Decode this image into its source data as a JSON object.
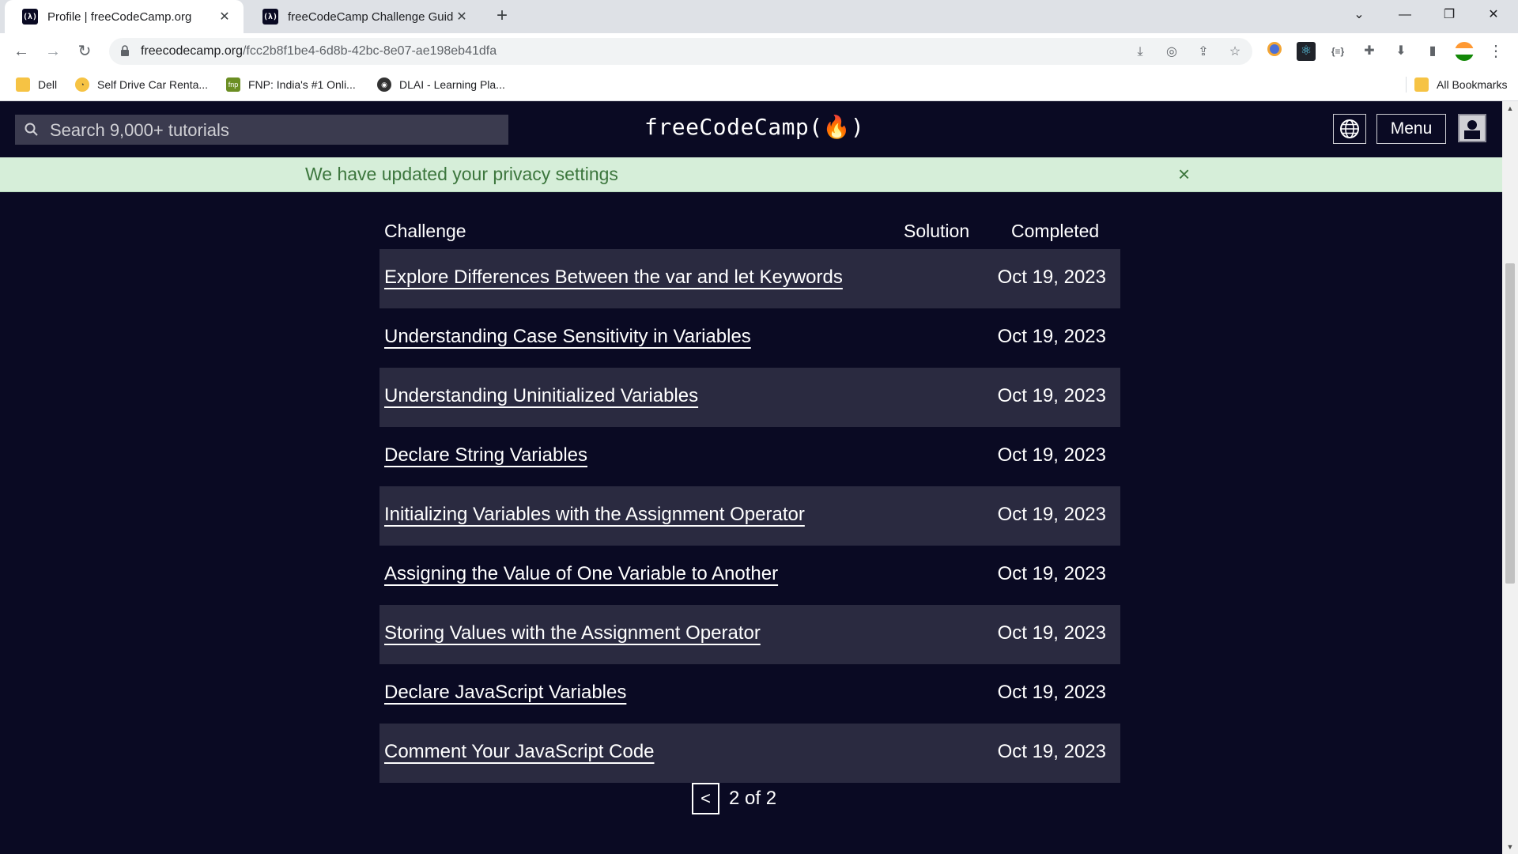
{
  "browser": {
    "tabs": [
      {
        "title": "Profile | freeCodeCamp.org",
        "active": true
      },
      {
        "title": "freeCodeCamp Challenge Guide",
        "active": false
      }
    ],
    "url_host": "freecodecamp.org",
    "url_path": "/fcc2b8f1be4-6d8b-42bc-8e07-ae198eb41dfa",
    "bookmarks": [
      {
        "label": "Dell",
        "icon": "folder-icon"
      },
      {
        "label": "Self Drive Car Renta...",
        "icon": "car-rental-icon"
      },
      {
        "label": "FNP: India's #1 Onli...",
        "icon": "fnp-icon"
      },
      {
        "label": "DLAI - Learning Pla...",
        "icon": "globe-icon"
      }
    ],
    "all_bookmarks": "All Bookmarks"
  },
  "nav": {
    "search_placeholder": "Search 9,000+ tutorials",
    "logo": "freeCodeCamp(🔥)",
    "menu_label": "Menu"
  },
  "flash": {
    "message": "We have updated your privacy settings",
    "close": "×"
  },
  "timeline": {
    "headers": {
      "challenge": "Challenge",
      "solution": "Solution",
      "completed": "Completed"
    },
    "rows": [
      {
        "challenge": "Explore Differences Between the var and let Keywords",
        "completed": "Oct 19, 2023"
      },
      {
        "challenge": "Understanding Case Sensitivity in Variables",
        "completed": "Oct 19, 2023"
      },
      {
        "challenge": "Understanding Uninitialized Variables",
        "completed": "Oct 19, 2023"
      },
      {
        "challenge": "Declare String Variables",
        "completed": "Oct 19, 2023"
      },
      {
        "challenge": "Initializing Variables with the Assignment Operator",
        "completed": "Oct 19, 2023"
      },
      {
        "challenge": "Assigning the Value of One Variable to Another",
        "completed": "Oct 19, 2023"
      },
      {
        "challenge": "Storing Values with the Assignment Operator",
        "completed": "Oct 19, 2023"
      },
      {
        "challenge": "Declare JavaScript Variables",
        "completed": "Oct 19, 2023"
      },
      {
        "challenge": "Comment Your JavaScript Code",
        "completed": "Oct 19, 2023"
      }
    ],
    "pager": {
      "prev": "<",
      "text": "2 of 2"
    }
  },
  "colors": {
    "page_bg": "#0a0a23",
    "row_alt": "#2a2a40",
    "flash_bg": "#d6eed9",
    "flash_text": "#3c763d"
  }
}
